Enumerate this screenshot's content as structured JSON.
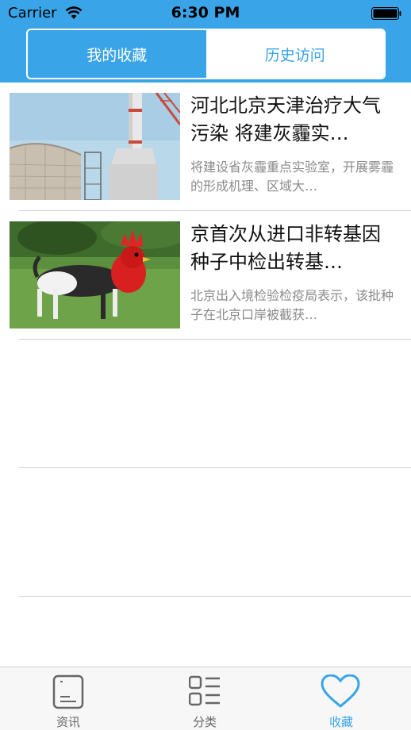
{
  "status_bar": {
    "carrier": "Carrier",
    "time": "6:30 PM",
    "wifi_icon": "wifi-icon",
    "battery_icon": "battery-icon"
  },
  "segment": {
    "tabs": [
      {
        "label": "我的收藏",
        "selected": true
      },
      {
        "label": "历史访问",
        "selected": false
      }
    ]
  },
  "articles": [
    {
      "title": "河北北京天津治疗大气污染 将建灰霾实…",
      "summary": "将建设省灰霾重点实验室，开展雾霾的形成机理、区域大…",
      "image": "chimney-photo"
    },
    {
      "title": "京首次从进口非转基因种子中检出转基…",
      "summary": "北京出入境检验检疫局表示，该批种子在北京口岸被截获…",
      "image": "rooster-dog-photo"
    }
  ],
  "tabbar": {
    "items": [
      {
        "label": "资讯",
        "icon": "news-icon"
      },
      {
        "label": "分类",
        "icon": "category-icon"
      },
      {
        "label": "收藏",
        "icon": "heart-icon",
        "active": true
      }
    ]
  },
  "colors": {
    "accent": "#3aa4e8",
    "separator": "#d0d0d0",
    "summary_text": "#8a8a8a"
  }
}
